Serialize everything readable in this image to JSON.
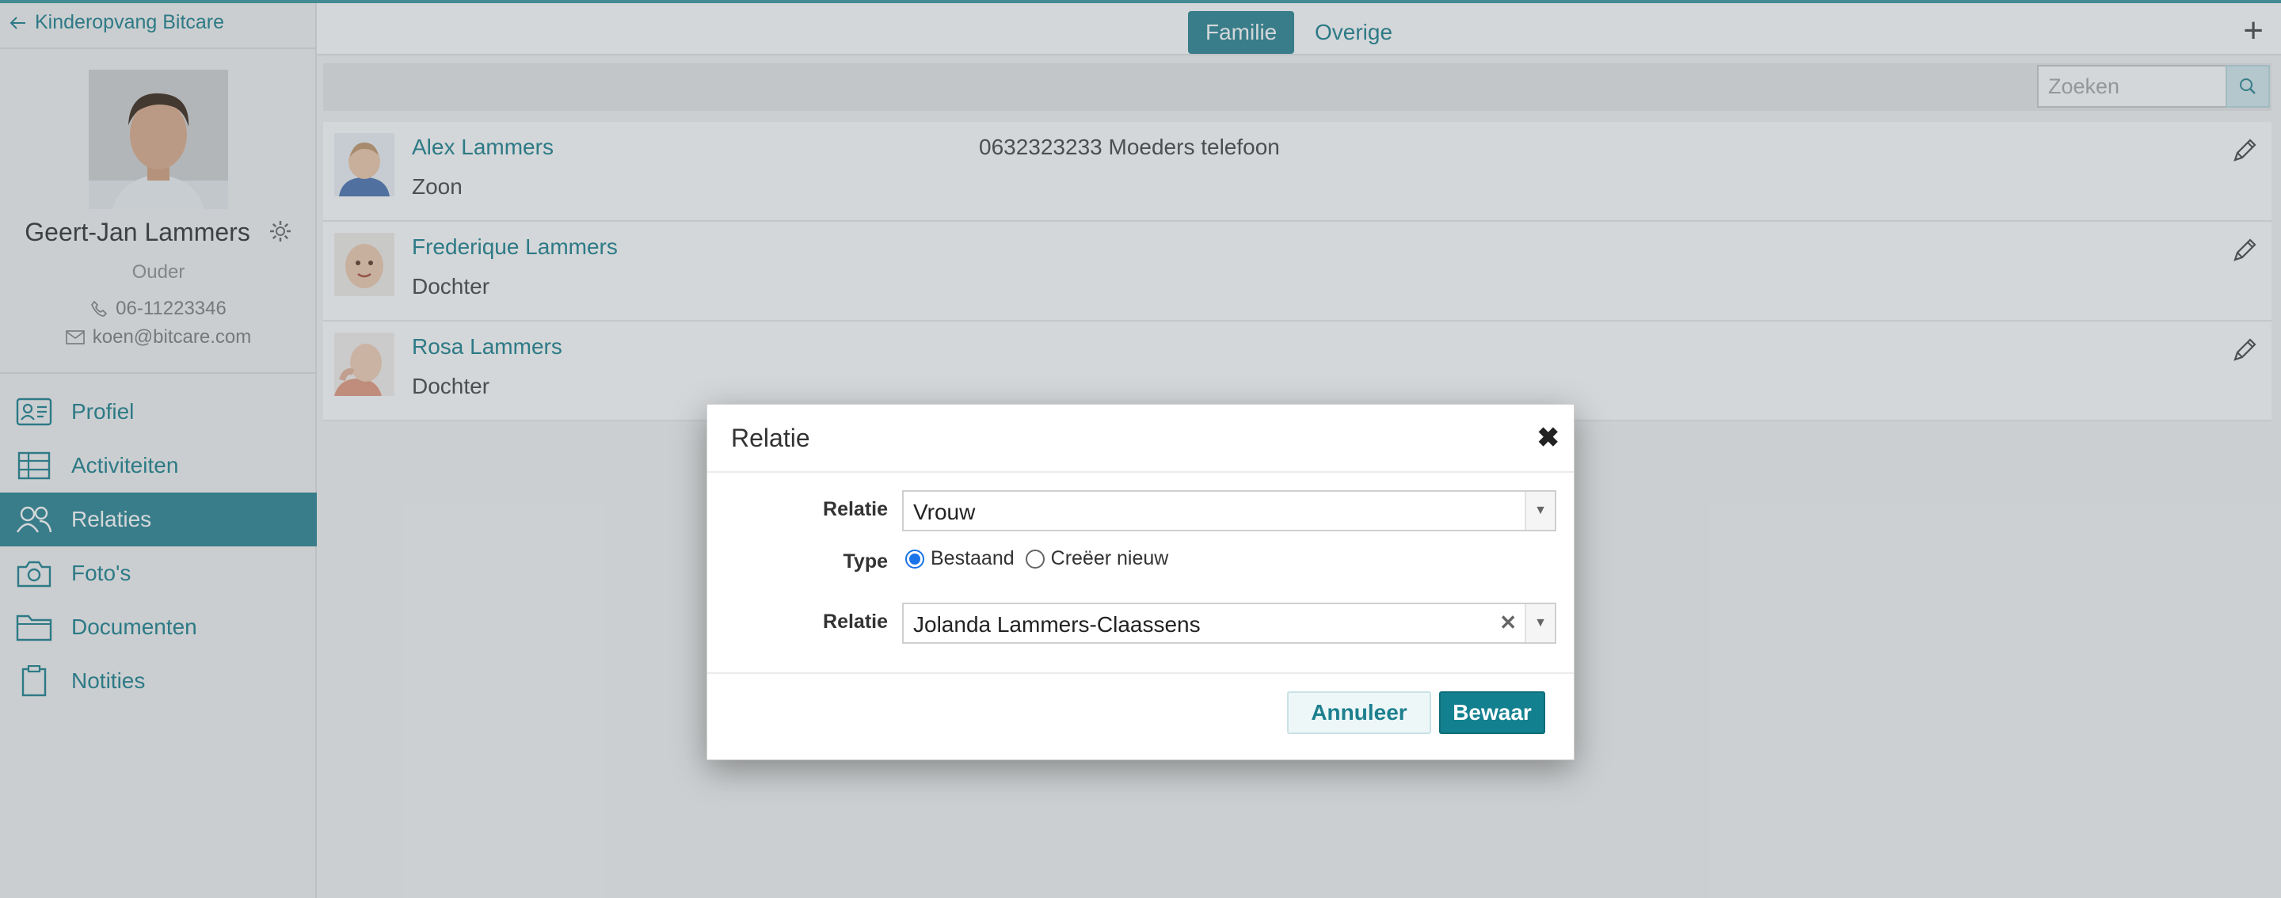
{
  "sidebar": {
    "back_label": "Kinderopvang Bitcare",
    "person": {
      "name": "Geert-Jan Lammers",
      "role": "Ouder",
      "phone": "06-11223346",
      "email": "koen@bitcare.com"
    },
    "nav": [
      {
        "label": "Profiel",
        "icon": "id-card-icon",
        "active": false
      },
      {
        "label": "Activiteiten",
        "icon": "table-icon",
        "active": false
      },
      {
        "label": "Relaties",
        "icon": "users-icon",
        "active": true
      },
      {
        "label": "Foto's",
        "icon": "camera-icon",
        "active": false
      },
      {
        "label": "Documenten",
        "icon": "folder-icon",
        "active": false
      },
      {
        "label": "Notities",
        "icon": "clipboard-icon",
        "active": false
      }
    ]
  },
  "header": {
    "tabs": [
      {
        "label": "Familie",
        "active": true
      },
      {
        "label": "Overige",
        "active": false
      }
    ],
    "add_icon": "plus-icon"
  },
  "search": {
    "placeholder": "Zoeken"
  },
  "relations": [
    {
      "name": "Alex Lammers",
      "relation": "Zoon",
      "phone": "0632323233 Moeders telefoon"
    },
    {
      "name": "Frederique Lammers",
      "relation": "Dochter",
      "phone": ""
    },
    {
      "name": "Rosa Lammers",
      "relation": "Dochter",
      "phone": ""
    }
  ],
  "modal": {
    "title": "Relatie",
    "fields": {
      "relatie_label": "Relatie",
      "relatie_value": "Vrouw",
      "type_label": "Type",
      "type_options": [
        "Bestaand",
        "Creëer nieuw"
      ],
      "type_selected": "Bestaand",
      "person_label": "Relatie",
      "person_value": "Jolanda Lammers-Claassens"
    },
    "cancel_label": "Annuleer",
    "save_label": "Bewaar"
  },
  "colors": {
    "accent": "#3d8f9c",
    "link": "#2f8b98",
    "save_button": "#13808f"
  }
}
